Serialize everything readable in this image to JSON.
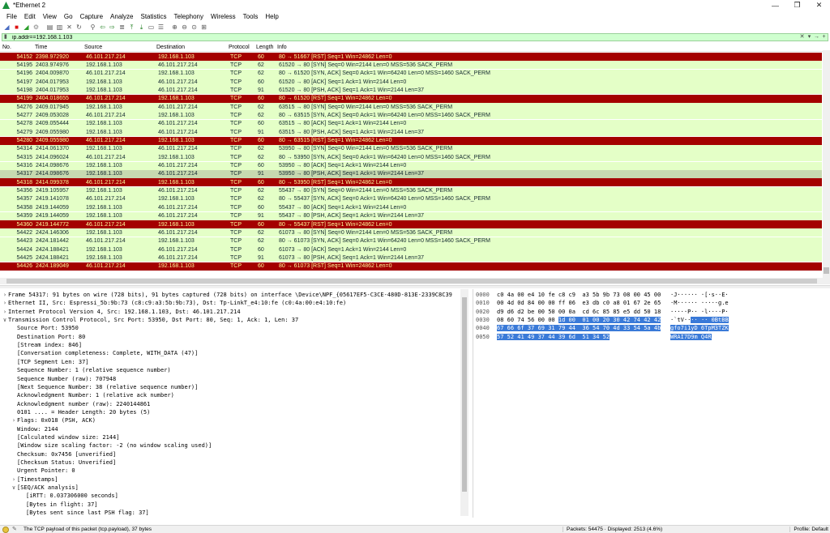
{
  "window": {
    "title": "*Ethernet 2",
    "minimize": "—",
    "maximize": "❐",
    "close": "✕"
  },
  "menu": [
    "File",
    "Edit",
    "View",
    "Go",
    "Capture",
    "Analyze",
    "Statistics",
    "Telephony",
    "Wireless",
    "Tools",
    "Help"
  ],
  "toolbar": {
    "icons": [
      "shark-fin-start-icon",
      "stop-capture-icon",
      "restart-capture-icon",
      "capture-options-icon",
      "open-file-icon",
      "save-file-icon",
      "close-file-icon",
      "reload-file-icon",
      "find-packet-icon",
      "go-back-icon",
      "go-forward-icon",
      "go-to-packet-icon",
      "go-first-icon",
      "go-last-icon",
      "autoscroll-icon",
      "colorize-icon",
      "zoom-in-icon",
      "zoom-out-icon",
      "zoom-normal-icon",
      "resize-columns-icon"
    ]
  },
  "filter": {
    "value": "ip.addr==192.168.1.103",
    "clear": "✕",
    "dropdown": "▾",
    "apply": "→",
    "add": "+"
  },
  "columns": [
    "No.",
    "Time",
    "Source",
    "Destination",
    "Protocol",
    "Length",
    "Info"
  ],
  "packets": [
    {
      "no": "54152",
      "time": "2398.972920",
      "src": "46.101.217.214",
      "dst": "192.168.1.103",
      "proto": "TCP",
      "len": "60",
      "info": "80 → 51667 [RST] Seq=1 Win=24862 Len=0",
      "type": "rst"
    },
    {
      "no": "54195",
      "time": "2403.974976",
      "src": "192.168.1.103",
      "dst": "46.101.217.214",
      "proto": "TCP",
      "len": "62",
      "info": "61520 → 80 [SYN] Seq=0 Win=2144 Len=0 MSS=536 SACK_PERM",
      "type": "normal"
    },
    {
      "no": "54196",
      "time": "2404.009870",
      "src": "46.101.217.214",
      "dst": "192.168.1.103",
      "proto": "TCP",
      "len": "62",
      "info": "80 → 61520 [SYN, ACK] Seq=0 Ack=1 Win=64240 Len=0 MSS=1460 SACK_PERM",
      "type": "normal"
    },
    {
      "no": "54197",
      "time": "2404.017953",
      "src": "192.168.1.103",
      "dst": "46.101.217.214",
      "proto": "TCP",
      "len": "60",
      "info": "61520 → 80 [ACK] Seq=1 Ack=1 Win=2144 Len=0",
      "type": "normal"
    },
    {
      "no": "54198",
      "time": "2404.017953",
      "src": "192.168.1.103",
      "dst": "46.101.217.214",
      "proto": "TCP",
      "len": "91",
      "info": "61520 → 80 [PSH, ACK] Seq=1 Ack=1 Win=2144 Len=37",
      "type": "normal"
    },
    {
      "no": "54199",
      "time": "2404.018655",
      "src": "46.101.217.214",
      "dst": "192.168.1.103",
      "proto": "TCP",
      "len": "60",
      "info": "80 → 61520 [RST] Seq=1 Win=24862 Len=0",
      "type": "rst"
    },
    {
      "no": "54276",
      "time": "2409.017945",
      "src": "192.168.1.103",
      "dst": "46.101.217.214",
      "proto": "TCP",
      "len": "62",
      "info": "63515 → 80 [SYN] Seq=0 Win=2144 Len=0 MSS=536 SACK_PERM",
      "type": "normal"
    },
    {
      "no": "54277",
      "time": "2409.053028",
      "src": "46.101.217.214",
      "dst": "192.168.1.103",
      "proto": "TCP",
      "len": "62",
      "info": "80 → 63515 [SYN, ACK] Seq=0 Ack=1 Win=64240 Len=0 MSS=1460 SACK_PERM",
      "type": "normal"
    },
    {
      "no": "54278",
      "time": "2409.055444",
      "src": "192.168.1.103",
      "dst": "46.101.217.214",
      "proto": "TCP",
      "len": "60",
      "info": "63515 → 80 [ACK] Seq=1 Ack=1 Win=2144 Len=0",
      "type": "normal"
    },
    {
      "no": "54279",
      "time": "2409.055980",
      "src": "192.168.1.103",
      "dst": "46.101.217.214",
      "proto": "TCP",
      "len": "91",
      "info": "63515 → 80 [PSH, ACK] Seq=1 Ack=1 Win=2144 Len=37",
      "type": "normal"
    },
    {
      "no": "54280",
      "time": "2409.055980",
      "src": "46.101.217.214",
      "dst": "192.168.1.103",
      "proto": "TCP",
      "len": "60",
      "info": "80 → 63515 [RST] Seq=1 Win=24862 Len=0",
      "type": "rst"
    },
    {
      "no": "54314",
      "time": "2414.061370",
      "src": "192.168.1.103",
      "dst": "46.101.217.214",
      "proto": "TCP",
      "len": "62",
      "info": "53950 → 80 [SYN] Seq=0 Win=2144 Len=0 MSS=536 SACK_PERM",
      "type": "normal"
    },
    {
      "no": "54315",
      "time": "2414.096024",
      "src": "46.101.217.214",
      "dst": "192.168.1.103",
      "proto": "TCP",
      "len": "62",
      "info": "80 → 53950 [SYN, ACK] Seq=0 Ack=1 Win=64240 Len=0 MSS=1460 SACK_PERM",
      "type": "normal"
    },
    {
      "no": "54316",
      "time": "2414.098676",
      "src": "192.168.1.103",
      "dst": "46.101.217.214",
      "proto": "TCP",
      "len": "60",
      "info": "53950 → 80 [ACK] Seq=1 Ack=1 Win=2144 Len=0",
      "type": "normal"
    },
    {
      "no": "54317",
      "time": "2414.098676",
      "src": "192.168.1.103",
      "dst": "46.101.217.214",
      "proto": "TCP",
      "len": "91",
      "info": "53950 → 80 [PSH, ACK] Seq=1 Ack=1 Win=2144 Len=37",
      "type": "sel"
    },
    {
      "no": "54318",
      "time": "2414.099378",
      "src": "46.101.217.214",
      "dst": "192.168.1.103",
      "proto": "TCP",
      "len": "60",
      "info": "80 → 53950 [RST] Seq=1 Win=24862 Len=0",
      "type": "rst"
    },
    {
      "no": "54356",
      "time": "2419.105957",
      "src": "192.168.1.103",
      "dst": "46.101.217.214",
      "proto": "TCP",
      "len": "62",
      "info": "55437 → 80 [SYN] Seq=0 Win=2144 Len=0 MSS=536 SACK_PERM",
      "type": "normal"
    },
    {
      "no": "54357",
      "time": "2419.141078",
      "src": "46.101.217.214",
      "dst": "192.168.1.103",
      "proto": "TCP",
      "len": "62",
      "info": "80 → 55437 [SYN, ACK] Seq=0 Ack=1 Win=64240 Len=0 MSS=1460 SACK_PERM",
      "type": "normal"
    },
    {
      "no": "54358",
      "time": "2419.144059",
      "src": "192.168.1.103",
      "dst": "46.101.217.214",
      "proto": "TCP",
      "len": "60",
      "info": "55437 → 80 [ACK] Seq=1 Ack=1 Win=2144 Len=0",
      "type": "normal"
    },
    {
      "no": "54359",
      "time": "2419.144059",
      "src": "192.168.1.103",
      "dst": "46.101.217.214",
      "proto": "TCP",
      "len": "91",
      "info": "55437 → 80 [PSH, ACK] Seq=1 Ack=1 Win=2144 Len=37",
      "type": "normal"
    },
    {
      "no": "54360",
      "time": "2419.144772",
      "src": "46.101.217.214",
      "dst": "192.168.1.103",
      "proto": "TCP",
      "len": "60",
      "info": "80 → 55437 [RST] Seq=1 Win=24862 Len=0",
      "type": "rst"
    },
    {
      "no": "54422",
      "time": "2424.146306",
      "src": "192.168.1.103",
      "dst": "46.101.217.214",
      "proto": "TCP",
      "len": "62",
      "info": "61073 → 80 [SYN] Seq=0 Win=2144 Len=0 MSS=536 SACK_PERM",
      "type": "normal"
    },
    {
      "no": "54423",
      "time": "2424.181442",
      "src": "46.101.217.214",
      "dst": "192.168.1.103",
      "proto": "TCP",
      "len": "62",
      "info": "80 → 61073 [SYN, ACK] Seq=0 Ack=1 Win=64240 Len=0 MSS=1460 SACK_PERM",
      "type": "normal"
    },
    {
      "no": "54424",
      "time": "2424.188421",
      "src": "192.168.1.103",
      "dst": "46.101.217.214",
      "proto": "TCP",
      "len": "60",
      "info": "61073 → 80 [ACK] Seq=1 Ack=1 Win=2144 Len=0",
      "type": "normal"
    },
    {
      "no": "54425",
      "time": "2424.188421",
      "src": "192.168.1.103",
      "dst": "46.101.217.214",
      "proto": "TCP",
      "len": "91",
      "info": "61073 → 80 [PSH, ACK] Seq=1 Ack=1 Win=2144 Len=37",
      "type": "normal"
    },
    {
      "no": "54426",
      "time": "2424.189049",
      "src": "46.101.217.214",
      "dst": "192.168.1.103",
      "proto": "TCP",
      "len": "60",
      "info": "80 → 61073 [RST] Seq=1 Win=24862 Len=0",
      "type": "rst"
    }
  ],
  "details": [
    {
      "text": "Frame 54317: 91 bytes on wire (728 bits), 91 bytes captured (728 bits) on interface \\Device\\NPF_{05617EF5-C3CE-480D-813E-2339C8C39",
      "level": 0,
      "exp": ">"
    },
    {
      "text": "Ethernet II, Src: Espressi_5b:9b:73 (c8:c9:a3:5b:9b:73), Dst: Tp-LinkT_e4:10:fe (c0:4a:00:e4:10:fe)",
      "level": 0,
      "exp": ">"
    },
    {
      "text": "Internet Protocol Version 4, Src: 192.168.1.103, Dst: 46.101.217.214",
      "level": 0,
      "exp": ">"
    },
    {
      "text": "Transmission Control Protocol, Src Port: 53950, Dst Port: 80, Seq: 1, Ack: 1, Len: 37",
      "level": 0,
      "exp": "v"
    },
    {
      "text": "Source Port: 53950",
      "level": 1,
      "exp": ""
    },
    {
      "text": "Destination Port: 80",
      "level": 1,
      "exp": ""
    },
    {
      "text": "[Stream index: 846]",
      "level": 1,
      "exp": ""
    },
    {
      "text": "[Conversation completeness: Complete, WITH_DATA (47)]",
      "level": 1,
      "exp": ""
    },
    {
      "text": "[TCP Segment Len: 37]",
      "level": 1,
      "exp": ""
    },
    {
      "text": "Sequence Number: 1    (relative sequence number)",
      "level": 1,
      "exp": ""
    },
    {
      "text": "Sequence Number (raw): 707948",
      "level": 1,
      "exp": ""
    },
    {
      "text": "[Next Sequence Number: 38    (relative sequence number)]",
      "level": 1,
      "exp": ""
    },
    {
      "text": "Acknowledgment Number: 1    (relative ack number)",
      "level": 1,
      "exp": ""
    },
    {
      "text": "Acknowledgment number (raw): 2240144861",
      "level": 1,
      "exp": ""
    },
    {
      "text": "0101 .... = Header Length: 20 bytes (5)",
      "level": 1,
      "exp": ""
    },
    {
      "text": "Flags: 0x018 (PSH, ACK)",
      "level": 1,
      "exp": ">"
    },
    {
      "text": "Window: 2144",
      "level": 1,
      "exp": ""
    },
    {
      "text": "[Calculated window size: 2144]",
      "level": 1,
      "exp": ""
    },
    {
      "text": "[Window size scaling factor: -2 (no window scaling used)]",
      "level": 1,
      "exp": ""
    },
    {
      "text": "Checksum: 0x7456 [unverified]",
      "level": 1,
      "exp": ""
    },
    {
      "text": "[Checksum Status: Unverified]",
      "level": 1,
      "exp": ""
    },
    {
      "text": "Urgent Pointer: 0",
      "level": 1,
      "exp": ""
    },
    {
      "text": "[Timestamps]",
      "level": 1,
      "exp": ">"
    },
    {
      "text": "[SEQ/ACK analysis]",
      "level": 1,
      "exp": "v"
    },
    {
      "text": "[iRTT: 0.037306000 seconds]",
      "level": 2,
      "exp": ""
    },
    {
      "text": "[Bytes in flight: 37]",
      "level": 2,
      "exp": ""
    },
    {
      "text": "[Bytes sent since last PSH flag: 37]",
      "level": 2,
      "exp": ""
    }
  ],
  "bytes": [
    {
      "off": "0000",
      "hex": "c0 4a 00 e4 10 fe c8 c9  a3 5b 9b 73 08 00 45 00",
      "hex_hl": "",
      "asc": "·J······ ·[·s··E·",
      "asc_hl": ""
    },
    {
      "off": "0010",
      "hex": "00 4d 0d 84 00 00 ff 06  e3 db c0 a8 01 67 2e 65",
      "hex_hl": "",
      "asc": "·M······ ·····g.e",
      "asc_hl": ""
    },
    {
      "off": "0020",
      "hex": "d9 d6 d2 be 00 50 00 0a  cd 6c 85 85 e5 dd 50 18",
      "hex_hl": "",
      "asc": "·····P·· ·l····P·",
      "asc_hl": ""
    },
    {
      "off": "0030",
      "hex": "08 60 74 56 00 00 ",
      "hex_hl": "1d 00  01 00 20 30 42 74 42 42",
      "asc": "·`tV··",
      "asc_hl": "·· ·· 0BtBB"
    },
    {
      "off": "0040",
      "hex": "",
      "hex_hl": "67 66 6f 37 69 31 79 44  36 54 70 4d 33 54 5a 4b",
      "asc": "",
      "asc_hl": "gfo7i1yD 6TpM3TZK"
    },
    {
      "off": "0050",
      "hex": "",
      "hex_hl": "57 52 41 49 37 44 39 6d  51 34 52",
      "asc": "",
      "asc_hl": "WRAI7D9m Q4R"
    }
  ],
  "status": {
    "message": "The TCP payload of this packet (tcp.payload), 37 bytes",
    "packets": "Packets: 54475 · Displayed: 2513 (4.6%)",
    "profile": "Profile: Default"
  }
}
